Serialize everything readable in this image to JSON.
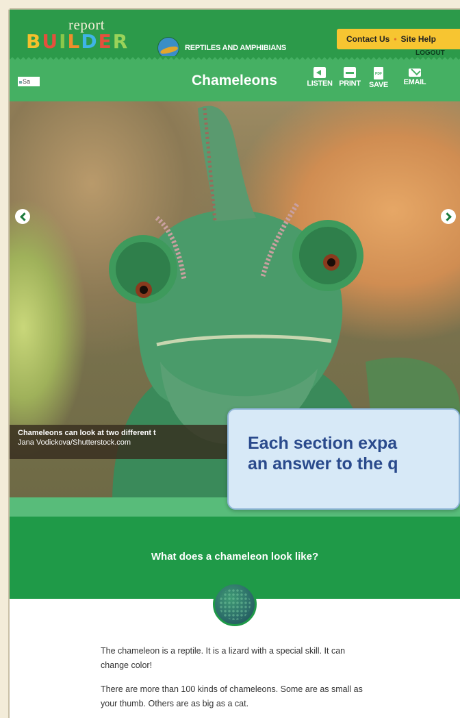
{
  "header": {
    "logo_small": "report",
    "logo_big": "BUILDER",
    "topic": "REPTILES AND AMPHIBIANS",
    "contact_label": "Contact Us",
    "site_help_label": "Site Help",
    "logout_label": "LOGOUT"
  },
  "titlebar": {
    "search_text": "Sa",
    "page_title": "Chameleons",
    "tools": {
      "listen": "LISTEN",
      "print": "PRINT",
      "save": "SAVE",
      "email": "EMAIL"
    }
  },
  "hero": {
    "caption_line1": "Chameleons can look at two different t",
    "caption_line2": "Jana Vodickova/Shutterstock.com"
  },
  "callout": {
    "line1": "Each section expa",
    "line2": "an answer to the q"
  },
  "section": {
    "question": "What does a chameleon look like?",
    "paragraphs": [
      "The chameleon is a reptile. It is a lizard with a special skill. It can change color!",
      "There are more than 100 kinds of chameleons. Some are as small as your thumb. Others are as big as a cat."
    ]
  },
  "colors": {
    "header_green": "#2c9a4a",
    "title_green": "#45b063",
    "section_green": "#1f9a48",
    "utility_yellow": "#f7c531",
    "callout_bg": "#d7e9f7",
    "callout_text": "#2a4a8c"
  }
}
